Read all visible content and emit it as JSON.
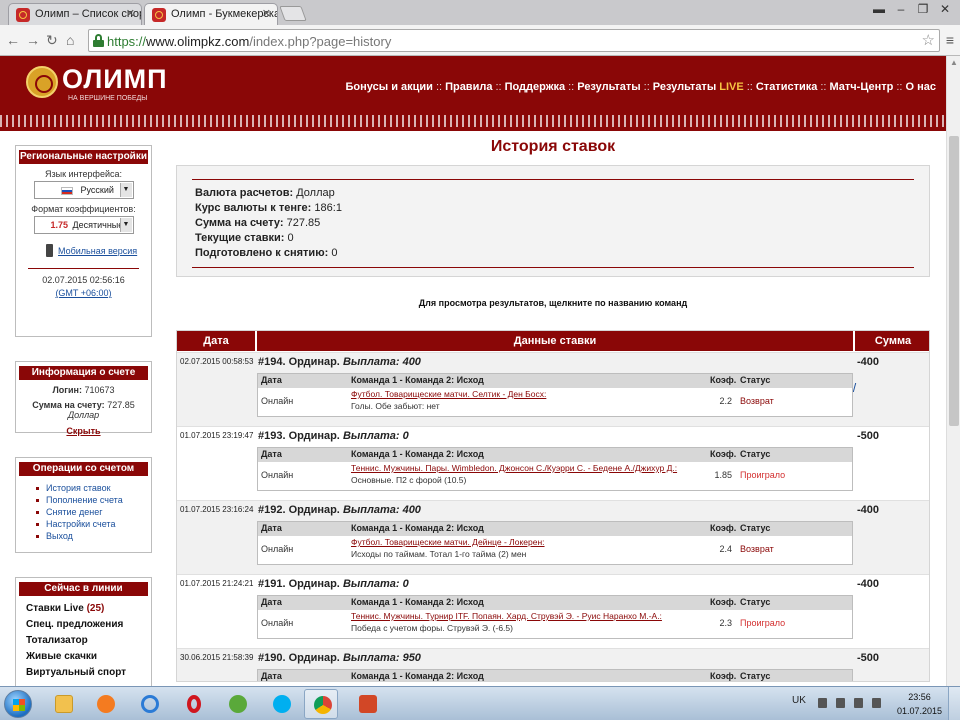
{
  "browser": {
    "tabs": [
      {
        "title": "Олимп – Список спортив",
        "active": false
      },
      {
        "title": "Олимп - Букмекерская к",
        "active": true
      }
    ],
    "url": {
      "protocol": "https://",
      "host": "www.olimpkz.com",
      "path": "/index.php?page=history"
    }
  },
  "header": {
    "logo_text": "ОЛИМП",
    "logo_tagline": "НА ВЕРШИНЕ ПОБЕДЫ",
    "nav": [
      "Бонусы и акции",
      "Правила",
      "Поддержка",
      "Результаты",
      "Результаты",
      "Статистика",
      "Матч-Центр",
      "О нас"
    ],
    "nav_live_suffix": "LIVE",
    "nav_separator": "::"
  },
  "regional": {
    "title": "Региональные настройки",
    "language_label": "Язык интерфейса:",
    "language_value": "Русский",
    "odds_format_label": "Формат коэффициентов:",
    "odds_sample": "1.75",
    "odds_format_value": "Десятичные",
    "mobile_link": "Мобильная версия",
    "datetime": "02.07.2015 02:56:16",
    "timezone": "(GMT +06:00)"
  },
  "account": {
    "title": "Информация о счете",
    "login_label": "Логин:",
    "login_value": "710673",
    "balance_label": "Сумма на счету:",
    "balance_value": "727.85",
    "balance_currency": "Доллар",
    "hide_link": "Скрыть"
  },
  "operations": {
    "title": "Операции со счетом",
    "items": [
      "История ставок",
      "Пополнение счета",
      "Снятие денег",
      "Настройки счета",
      "Выход"
    ]
  },
  "in_line": {
    "title": "Сейчас в линии",
    "items": [
      {
        "label": "Ставки Live",
        "count": "(25)"
      },
      {
        "label": "Спец. предложения",
        "count": ""
      },
      {
        "label": "Тотализатор",
        "count": ""
      },
      {
        "label": "Живые скачки",
        "count": ""
      },
      {
        "label": "Виртуальный спорт",
        "count": ""
      }
    ]
  },
  "main": {
    "title": "История ставок",
    "summary": [
      {
        "label": "Валюта расчетов:",
        "value": "Доллар"
      },
      {
        "label": "Курс валюты к тенге:",
        "value": "186:1"
      },
      {
        "label": "Сумма на счету:",
        "value": "727.85"
      },
      {
        "label": "Текущие ставки:",
        "value": "0"
      },
      {
        "label": "Подготовлено к снятию:",
        "value": "0"
      }
    ],
    "hint": "Для просмотра результатов, щелкните по названию команд",
    "columns": {
      "date": "Дата",
      "details": "Данные ставки",
      "amount": "Сумма"
    },
    "inner_columns": {
      "date": "Дата",
      "teams": "Команда 1 - Команда 2: Исход",
      "coef": "Коэф.",
      "status": "Статус"
    },
    "bets": [
      {
        "date": "02.07.2015 00:58:53",
        "title": "#194. Ординар.",
        "payout": "Выплата: 400",
        "amount": "-400",
        "type": "Онлайн",
        "event": "Футбол. Товарищеские матчи. Селтик - Ден Босх:",
        "outcome": "Голы. Обе забьют: нет",
        "coef": "2.2",
        "status": "Возврат",
        "status_kind": "return"
      },
      {
        "date": "01.07.2015 23:19:47",
        "title": "#193. Ординар.",
        "payout": "Выплата: 0",
        "amount": "-500",
        "type": "Онлайн",
        "event": "Теннис. Мужчины. Пары. Wimbledon. Джонсон С./Куэрри С. - Бедене А./Джихур Д.:",
        "outcome": "Основные. П2 с форой (10.5)",
        "coef": "1.85",
        "status": "Проиграло",
        "status_kind": "lost"
      },
      {
        "date": "01.07.2015 23:16:24",
        "title": "#192. Ординар.",
        "payout": "Выплата: 400",
        "amount": "-400",
        "type": "Онлайн",
        "event": "Футбол. Товарищеские матчи. Дейнце - Локерен:",
        "outcome": "Исходы по таймам. Тотал 1-го тайма (2) мен",
        "coef": "2.4",
        "status": "Возврат",
        "status_kind": "return"
      },
      {
        "date": "01.07.2015 21:24:21",
        "title": "#191. Ординар.",
        "payout": "Выплата: 0",
        "amount": "-400",
        "type": "Онлайн",
        "event": "Теннис. Мужчины. Турнир ITF. Попаян. Хард. Струвэй Э. - Руис Наранхо М.-А.:",
        "outcome": "Победа с учетом форы. Струвэй Э. (-6.5)",
        "coef": "2.3",
        "status": "Проиграло",
        "status_kind": "lost"
      },
      {
        "date": "30.06.2015 21:58:39",
        "title": "#190. Ординар.",
        "payout": "Выплата: 950",
        "amount": "-500",
        "type": "",
        "event": "",
        "outcome": "",
        "coef": "",
        "status": "",
        "status_kind": ""
      }
    ]
  },
  "taskbar": {
    "apps": [
      "explorer-folder",
      "avast",
      "internet-explorer",
      "opera",
      "utorrent",
      "skype",
      "chrome",
      "powerpoint"
    ],
    "active_app": "chrome",
    "language": "UK",
    "time": "23:56",
    "date": "01.07.2015"
  },
  "colors": {
    "brand": "#8a0707",
    "live": "#f6c343",
    "link": "#1a4f9c",
    "lost": "#d32f2f"
  }
}
